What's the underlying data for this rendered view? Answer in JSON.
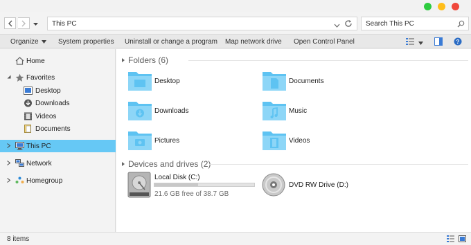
{
  "window": {
    "controls": {
      "green": "#2ecc40",
      "yellow": "#ffbe1a",
      "red": "#f0473b"
    }
  },
  "address": {
    "path": "This PC",
    "search_placeholder": "Search This PC"
  },
  "toolbar": {
    "organize": "Organize",
    "system_properties": "System properties",
    "uninstall": "Uninstall or change a program",
    "map_drive": "Map network drive",
    "control_panel": "Open Control Panel"
  },
  "sidebar": {
    "home": "Home",
    "favorites": "Favorites",
    "favorites_items": [
      "Desktop",
      "Downloads",
      "Videos",
      "Documents"
    ],
    "this_pc": "This PC",
    "network": "Network",
    "homegroup": "Homegroup",
    "selected_color": "#66c8f5"
  },
  "folders": {
    "header": "Folders (6)",
    "items": [
      "Desktop",
      "Documents",
      "Downloads",
      "Music",
      "Pictures",
      "Videos"
    ],
    "icon_color": "#5ec3f2"
  },
  "devices": {
    "header": "Devices and drives (2)",
    "local_disk": {
      "name": "Local Disk (C:)",
      "free_text": "21.6 GB free of 38.7 GB",
      "used_fraction": 0.44
    },
    "dvd": {
      "name": "DVD RW Drive (D:)"
    }
  },
  "status": {
    "items": "8 items"
  }
}
